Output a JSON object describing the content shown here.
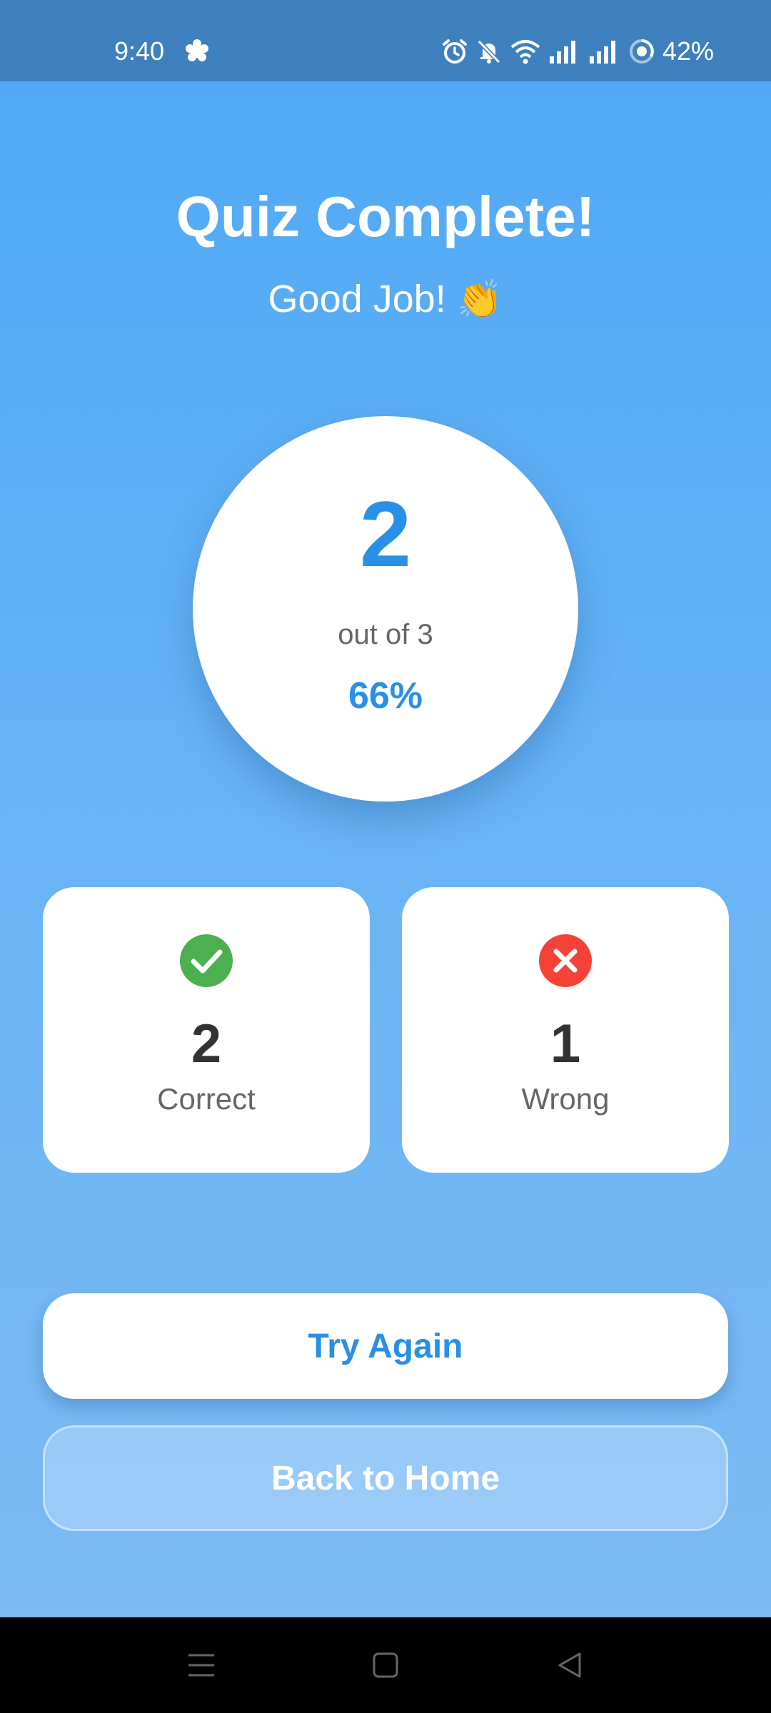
{
  "status_bar": {
    "time": "9:40",
    "battery": "42%",
    "icons": [
      "settings-flower-icon",
      "alarm-icon",
      "bell-muted-icon",
      "wifi-icon",
      "signal-icon",
      "signal-icon",
      "battery-saver-icon"
    ]
  },
  "result": {
    "title": "Quiz Complete!",
    "message": "Good Job!",
    "emoji": "👏",
    "score": "2",
    "out_of": "out of 3",
    "percent": "66%"
  },
  "stats": {
    "correct": {
      "value": "2",
      "label": "Correct",
      "icon": "check-circle-icon",
      "color": "#4caf50"
    },
    "wrong": {
      "value": "1",
      "label": "Wrong",
      "icon": "x-circle-icon",
      "color": "#f44336"
    }
  },
  "actions": {
    "try_again": "Try Again",
    "back_home": "Back to Home"
  },
  "nav_bar": {
    "icons": [
      "recents-icon",
      "home-icon",
      "back-icon"
    ]
  },
  "colors": {
    "accent": "#2a8fe6",
    "status_bar_bg": "#3d80bd",
    "background_top": "#51a9f5",
    "background_bottom": "#7bbaf4"
  }
}
